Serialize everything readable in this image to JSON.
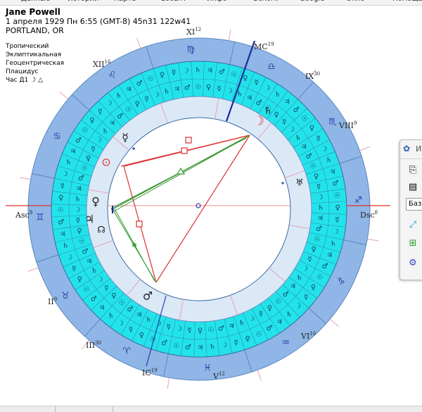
{
  "top_menu": [
    "Данные",
    "Истории",
    "Карта",
    "Событ.",
    "Инфо",
    "Вспом.",
    "Google",
    "Окно",
    "Помощь"
  ],
  "person": {
    "name": "Jane Powell",
    "date_line": "1 апреля 1929  Пн   6:55 (GMT-8) 45n31  122w41",
    "place": "PORTLAND, OR"
  },
  "settings": {
    "zodiac": "Тропический",
    "coords": "Эклиптикальная",
    "center": "Геоцентрическая",
    "houses": "Плацидус",
    "hour_label": "Час Д1",
    "hour_glyphs": "☽ △"
  },
  "angles": {
    "asc": {
      "label": "Asc",
      "deg": "8"
    },
    "dsc": {
      "label": "Dsc",
      "deg": "8"
    },
    "mc": {
      "label": "MC",
      "deg": "19"
    },
    "ic": {
      "label": "IC",
      "deg": "19"
    }
  },
  "cusps": [
    {
      "label": "II",
      "deg": "9"
    },
    {
      "label": "III",
      "deg": "30"
    },
    {
      "label": "V",
      "deg": "12"
    },
    {
      "label": "VI",
      "deg": "16"
    },
    {
      "label": "VIII",
      "deg": "9"
    },
    {
      "label": "IX",
      "deg": "30"
    },
    {
      "label": "XI",
      "deg": "12"
    },
    {
      "label": "XII",
      "deg": "16"
    }
  ],
  "zodiac_glyphs": [
    "♈",
    "♉",
    "♊",
    "♋",
    "♌",
    "♍",
    "♎",
    "♏",
    "♐",
    "♑",
    "♒",
    "♓"
  ],
  "planets_in_chart": [
    "☽",
    "♄",
    "☿",
    "⊙",
    "♀",
    "♃",
    "☊",
    "♂",
    "♅",
    "♆"
  ],
  "decan_glyphs": [
    "♂",
    "☉",
    "♀",
    "☿",
    "☽",
    "♄",
    "♃"
  ],
  "colors": {
    "outer_ring": "#8fb6e6",
    "outer_ring_dark": "#6f9ad0",
    "decan_ring": "#23e3ea",
    "inner_ring": "#dbe9f7",
    "center_fill": "#ffffff",
    "aspect_red": "#e03030",
    "aspect_green": "#2f9a2f",
    "axis_red": "#e03030",
    "mc_axis": "#1a2a9a",
    "cusp_lines": "#e7a0b8"
  },
  "side_panel": {
    "title_glyph": "И",
    "field_text": "Баз"
  }
}
